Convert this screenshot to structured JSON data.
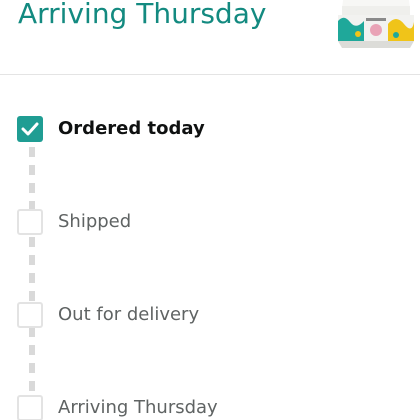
{
  "header": {
    "title": "Arriving Thursday"
  },
  "colors": {
    "accent": "#138a80",
    "check_fill": "#1f9d93",
    "pending_border": "#e3e3e3",
    "active_text": "#0f1111",
    "pending_text": "#5f6363"
  },
  "steps": [
    {
      "label": "Ordered today",
      "completed": true
    },
    {
      "label": "Shipped",
      "completed": false
    },
    {
      "label": "Out for delivery",
      "completed": false
    },
    {
      "label": "Arriving Thursday",
      "completed": false
    }
  ]
}
